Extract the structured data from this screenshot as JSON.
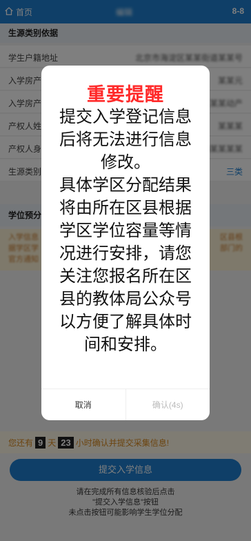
{
  "topbar": {
    "home_label": "首页",
    "title": "编辑",
    "step": "8-8"
  },
  "section1": {
    "title": "生源类别依据",
    "rows": [
      {
        "label": "学生户籍地址",
        "value": "北京市海淀区某某街道某某号"
      },
      {
        "label": "入学房产",
        "value": "某某元"
      },
      {
        "label": "入学房产",
        "value": "某某动产"
      },
      {
        "label": "产权人姓",
        "value": "某某某"
      },
      {
        "label": "产权人身",
        "value": "70某某某某"
      },
      {
        "label": "生源类别",
        "value": "三类"
      }
    ]
  },
  "section2": {
    "title": "学位预分",
    "notice_left": "入学信息\n据学区学\n官方通知",
    "notice_right": "区县根\n部门的"
  },
  "countdown": {
    "prefix": "您还有",
    "days": "9",
    "days_unit": "天",
    "hours": "23",
    "suffix": "小时确认并提交采集信息!"
  },
  "submit_label": "提交入学信息",
  "footnote": [
    "请在完成所有信息核验后点击",
    "\"提交入学信息\"按钮",
    "未点击按钮可能影响学生学位分配"
  ],
  "modal": {
    "title": "重要提醒",
    "paragraph1": "提交入学登记信息后将无法进行信息修改。",
    "paragraph2": "具体学区分配结果将由所在区县根据学区学位容量等情况进行安排，请您关注您报名所在区县的教体局公众号以方便了解具体时间和安排。",
    "cancel_label": "取消",
    "confirm_label": "确认(4s)"
  },
  "colors": {
    "primary": "#1e7fd0",
    "alert_red": "#ff2a2a",
    "warning": "#d8891f"
  }
}
